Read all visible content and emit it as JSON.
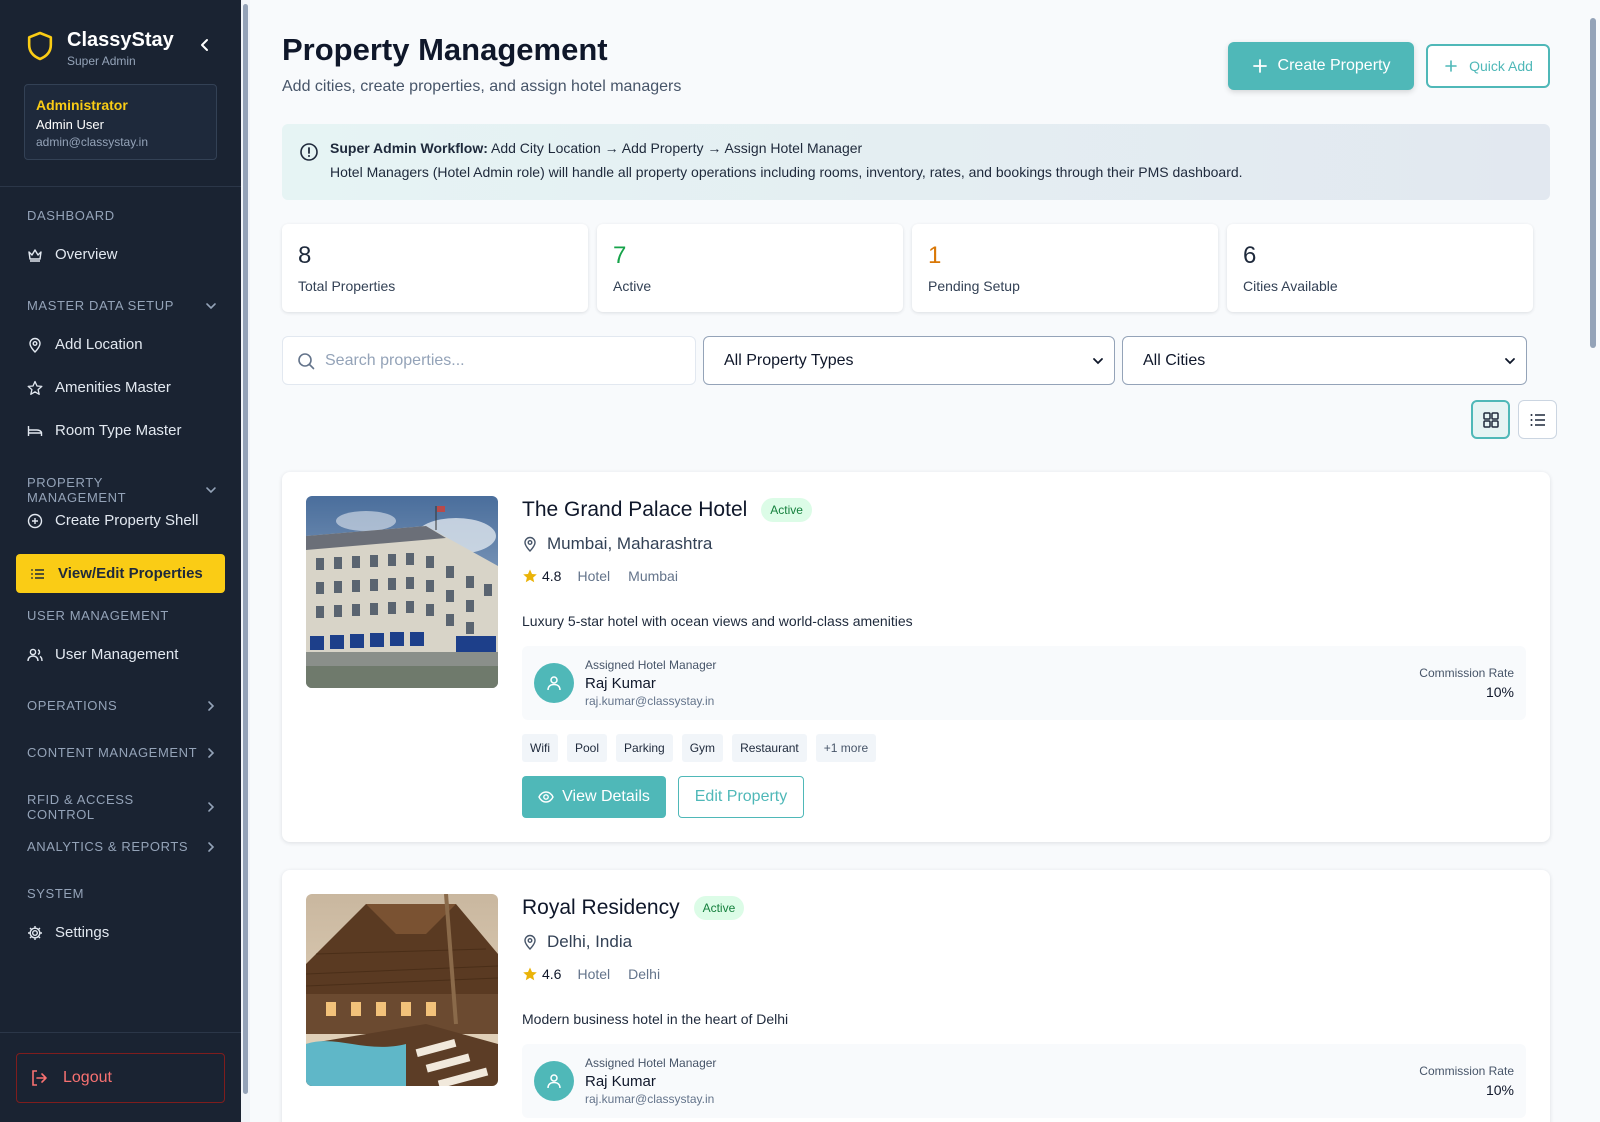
{
  "sidebar": {
    "brand_name": "ClassyStay",
    "brand_role": "Super Admin",
    "user_role": "Administrator",
    "user_name": "Admin User",
    "user_email": "admin@classystay.in",
    "sections": {
      "dashboard": "DASHBOARD",
      "master_data": "MASTER DATA SETUP",
      "property_mgmt": "PROPERTY MANAGEMENT",
      "user_mgmt": "USER MANAGEMENT",
      "operations": "OPERATIONS",
      "content_mgmt": "CONTENT MANAGEMENT",
      "rfid": "RFID & ACCESS CONTROL",
      "analytics": "ANALYTICS & REPORTS",
      "system": "SYSTEM"
    },
    "items": {
      "overview": "Overview",
      "add_location": "Add Location",
      "amenities_master": "Amenities Master",
      "room_type_master": "Room Type Master",
      "create_property_shell": "Create Property Shell",
      "view_edit_properties": "View/Edit Properties",
      "user_management": "User Management",
      "settings": "Settings"
    },
    "logout": "Logout"
  },
  "header": {
    "title": "Property Management",
    "subtitle": "Add cities, create properties, and assign hotel managers",
    "create_button": "Create Property",
    "quick_add_button": "Quick Add"
  },
  "info": {
    "bold": "Super Admin Workflow:",
    "workflow": " Add City Location → Add Property → Assign Hotel Manager",
    "line2": "Hotel Managers (Hotel Admin role) will handle all property operations including rooms, inventory, rates, and bookings through their PMS dashboard."
  },
  "stats": [
    {
      "value": "8",
      "label": "Total Properties",
      "color": "#1e293b"
    },
    {
      "value": "7",
      "label": "Active",
      "color": "#16a34a"
    },
    {
      "value": "1",
      "label": "Pending Setup",
      "color": "#d97706"
    },
    {
      "value": "6",
      "label": "Cities Available",
      "color": "#1e293b"
    }
  ],
  "filters": {
    "search_placeholder": "Search properties...",
    "property_type": "All Property Types",
    "city": "All Cities"
  },
  "properties": [
    {
      "name": "The Grand Palace Hotel",
      "status": "Active",
      "location": "Mumbai, Maharashtra",
      "rating": "4.8",
      "type": "Hotel",
      "city": "Mumbai",
      "description": "Luxury 5-star hotel with ocean views and world-class amenities",
      "manager_label": "Assigned Hotel Manager",
      "manager_name": "Raj Kumar",
      "manager_email": "raj.kumar@classystay.in",
      "commission_label": "Commission Rate",
      "commission": "10%",
      "amenities": [
        "Wifi",
        "Pool",
        "Parking",
        "Gym",
        "Restaurant"
      ],
      "more": "+1 more",
      "view_button": "View Details",
      "edit_button": "Edit Property"
    },
    {
      "name": "Royal Residency",
      "status": "Active",
      "location": "Delhi, India",
      "rating": "4.6",
      "type": "Hotel",
      "city": "Delhi",
      "description": "Modern business hotel in the heart of Delhi",
      "manager_label": "Assigned Hotel Manager",
      "manager_name": "Raj Kumar",
      "manager_email": "raj.kumar@classystay.in",
      "commission_label": "Commission Rate",
      "commission": "10%"
    }
  ],
  "colors": {
    "accent": "#4fb8b8",
    "sidebar_bg": "#1a2332",
    "highlight": "#facc15"
  }
}
